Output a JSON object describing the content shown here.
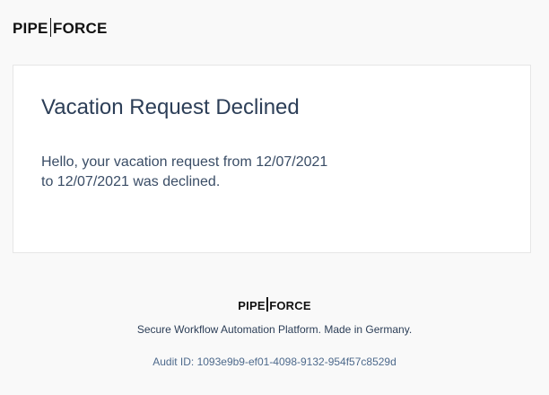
{
  "header": {
    "logo": {
      "left": "PIPE",
      "right": "FORCE"
    }
  },
  "card": {
    "title": "Vacation Request Declined",
    "message_line1": "Hello, your vacation request from 12/07/2021",
    "message_line2": "to 12/07/2021 was declined."
  },
  "footer": {
    "logo": {
      "left": "PIPE",
      "right": "FORCE"
    },
    "tagline": "Secure Workflow Automation Platform. Made in Germany.",
    "audit": "Audit ID: 1093e9b9-ef01-4098-9132-954f57c8529d"
  },
  "colors": {
    "background": "#f9f9f9",
    "card": "#ffffff",
    "title": "#2c3e57",
    "audit": "#4e6a8c"
  }
}
